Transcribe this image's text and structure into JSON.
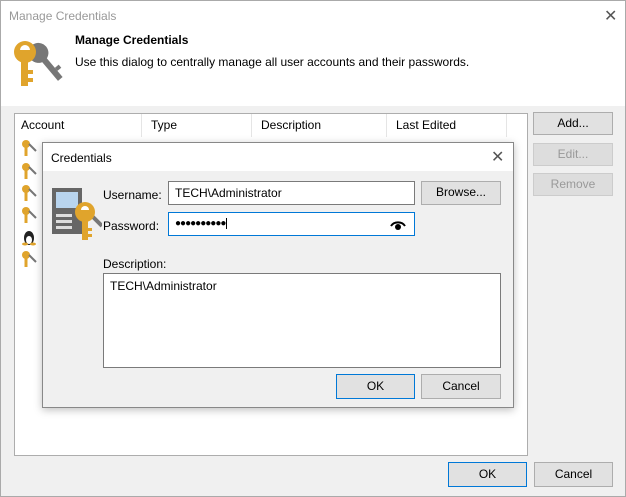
{
  "window": {
    "title": "Manage Credentials"
  },
  "header": {
    "title": "Manage Credentials",
    "description": "Use this dialog to centrally manage all user accounts and their passwords."
  },
  "list": {
    "columns": [
      "Account",
      "Type",
      "Description",
      "Last Edited"
    ],
    "row_icons": [
      "key-icon",
      "key-icon",
      "key-icon",
      "key-icon",
      "linux-icon",
      "key-icon"
    ]
  },
  "side_buttons": {
    "add": "Add...",
    "edit": "Edit...",
    "remove": "Remove"
  },
  "footer": {
    "ok": "OK",
    "cancel": "Cancel"
  },
  "dialog": {
    "title": "Credentials",
    "username_label": "Username:",
    "username_value": "TECH\\Administrator",
    "browse": "Browse...",
    "password_label": "Password:",
    "password_value": "●●●●●●●●●●",
    "description_label": "Description:",
    "description_value": "TECH\\Administrator",
    "ok": "OK",
    "cancel": "Cancel"
  },
  "colors": {
    "accent": "#0078d7",
    "key": "#e0a42c"
  }
}
